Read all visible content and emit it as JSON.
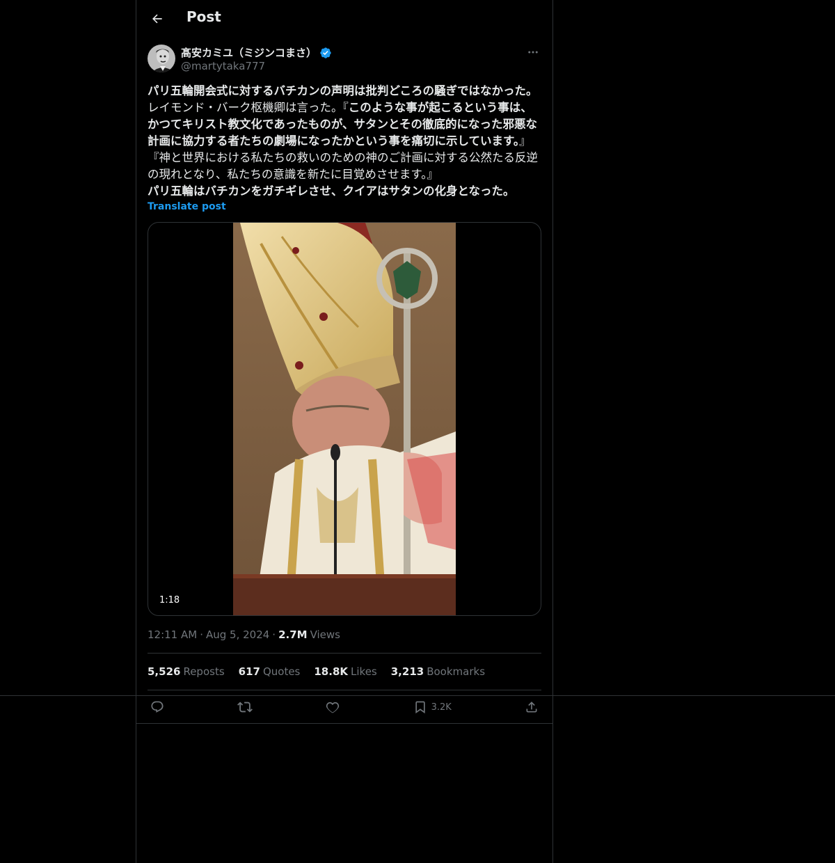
{
  "header": {
    "title": "Post",
    "back_icon": "arrow-left-icon"
  },
  "author": {
    "display_name": "髙安カミユ（ミジンコまさ）",
    "handle": "@martytaka777",
    "verified_color": "#1d9bf0"
  },
  "post": {
    "segments": [
      {
        "text": "パリ五輪開会式に対するバチカンの声明は批判どころの騒ぎではなかった。",
        "bold": true
      },
      {
        "text": "レイモンド・バーク枢機卿は言った。『",
        "bold": false
      },
      {
        "text": "このような事が起こるという事は、かつてキリスト教文化であったものが、サタンとその徹底的になった邪悪な計画に協力する者たちの劇場になったかという事を痛切に示しています。",
        "bold": true
      },
      {
        "text": "』『神と世界における私たちの救いのための神のご計画に対する公然たる反逆の現れとなり、私たちの意識を新たに目覚めさせます。』",
        "bold": false
      },
      {
        "text": "パリ五輪はバチカンをガチギレさせ、クイアはサタンの化身となった。",
        "bold": true
      }
    ],
    "translate_label": "Translate post",
    "video_duration": "1:18"
  },
  "meta": {
    "time": "12:11 AM",
    "date": "Aug 5, 2024",
    "views_count": "2.7M",
    "views_label": "Views",
    "dot": "·"
  },
  "stats": [
    {
      "count": "5,526",
      "label": "Reposts"
    },
    {
      "count": "617",
      "label": "Quotes"
    },
    {
      "count": "18.8K",
      "label": "Likes"
    },
    {
      "count": "3,213",
      "label": "Bookmarks"
    }
  ],
  "actions": {
    "bookmark_count": "3.2K"
  },
  "colors": {
    "accent": "#1d9bf0",
    "muted": "#71767b",
    "border": "#2f3336"
  }
}
